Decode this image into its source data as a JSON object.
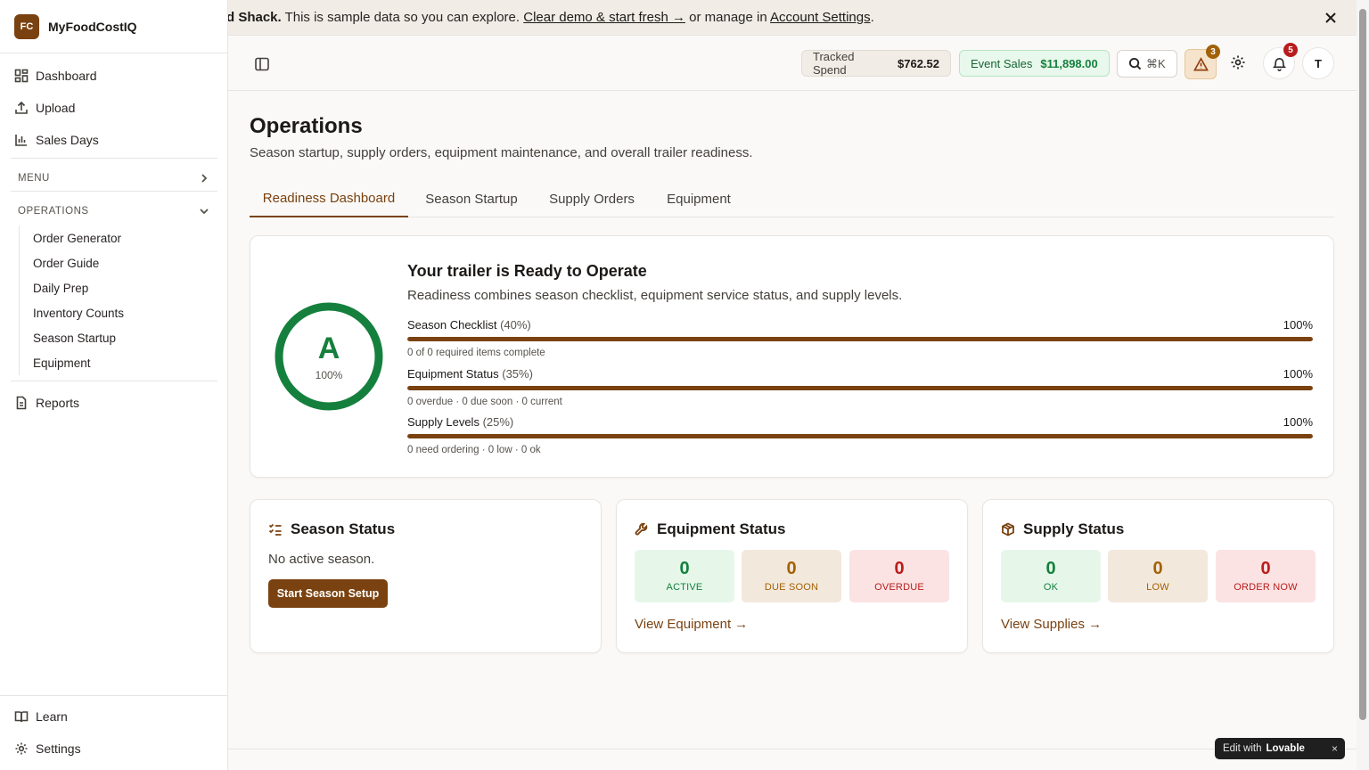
{
  "app": {
    "logo": "FC",
    "name": "MyFoodCostIQ"
  },
  "sidebar": {
    "top_items": [
      {
        "label": "Dashboard",
        "icon": "dashboard-icon"
      },
      {
        "label": "Upload",
        "icon": "upload-icon"
      },
      {
        "label": "Sales Days",
        "icon": "bar-chart-icon"
      }
    ],
    "menu_label": "MENU",
    "operations_label": "OPERATIONS",
    "operations_items": [
      "Order Generator",
      "Order Guide",
      "Daily Prep",
      "Inventory Counts",
      "Season Startup",
      "Equipment"
    ],
    "reports": "Reports",
    "footer": [
      {
        "label": "Learn",
        "icon": "book-icon"
      },
      {
        "label": "Settings",
        "icon": "gear-icon"
      }
    ]
  },
  "banner": {
    "bold": "d Shack.",
    "text1": " This is sample data so you can explore. ",
    "link1": "Clear demo & start fresh →",
    "text2": " or manage in ",
    "link2": "Account Settings",
    "text3": "."
  },
  "header": {
    "tracked_label": "Tracked Spend",
    "tracked_value": "$762.52",
    "sales_label": "Event Sales",
    "sales_value": "$11,898.00",
    "search_shortcut": "⌘K",
    "alert_count": "3",
    "notif_count": "5",
    "avatar": "T"
  },
  "page": {
    "title": "Operations",
    "subtitle": "Season startup, supply orders, equipment maintenance, and overall trailer readiness."
  },
  "tabs": [
    "Readiness Dashboard",
    "Season Startup",
    "Supply Orders",
    "Equipment"
  ],
  "readiness": {
    "grade": "A",
    "score": "100%",
    "score_fraction": 1.0,
    "title": "Your trailer is Ready to Operate",
    "subtitle": "Readiness combines season checklist, equipment service status, and supply levels.",
    "metrics": [
      {
        "label": "Season Checklist",
        "weight": "(40%)",
        "value": "100%",
        "fraction": 1.0,
        "note": "0 of 0 required items complete"
      },
      {
        "label": "Equipment Status",
        "weight": "(35%)",
        "value": "100%",
        "fraction": 1.0,
        "note": "0 overdue · 0 due soon · 0 current"
      },
      {
        "label": "Supply Levels",
        "weight": "(25%)",
        "value": "100%",
        "fraction": 1.0,
        "note": "0 need ordering · 0 low · 0 ok"
      }
    ]
  },
  "season_status": {
    "title": "Season Status",
    "text": "No active season.",
    "button": "Start Season Setup"
  },
  "equipment_status": {
    "title": "Equipment Status",
    "boxes": [
      {
        "value": "0",
        "label": "ACTIVE"
      },
      {
        "value": "0",
        "label": "DUE SOON"
      },
      {
        "value": "0",
        "label": "OVERDUE"
      }
    ],
    "link": "View Equipment →"
  },
  "supply_status": {
    "title": "Supply Status",
    "boxes": [
      {
        "value": "0",
        "label": "OK"
      },
      {
        "value": "0",
        "label": "LOW"
      },
      {
        "value": "0",
        "label": "ORDER NOW"
      }
    ],
    "link": "View Supplies →"
  },
  "lovable": {
    "prefix": "Edit with",
    "brand": "Lovable",
    "close": "×"
  },
  "colors": {
    "accent": "#7a4210",
    "success": "#15803d",
    "warning": "#a16207",
    "danger": "#b91c1c"
  }
}
